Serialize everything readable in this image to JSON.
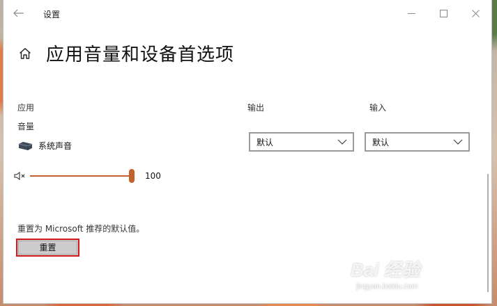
{
  "window": {
    "title": "设置",
    "page_title": "应用音量和设备首选项"
  },
  "columns": {
    "app_header": "应用",
    "output_header": "输出",
    "input_header": "输入"
  },
  "volume_label": "音量",
  "app": {
    "name": "系统声音",
    "volume": 100,
    "volume_text": "100"
  },
  "output_select": {
    "value": "默认"
  },
  "input_select": {
    "value": "默认"
  },
  "reset": {
    "description": "重置为 Microsoft 推荐的默认值。",
    "button_label": "重置"
  },
  "watermark": {
    "logo": "Bai 经验",
    "url": "jingyan.baidu.com"
  },
  "colors": {
    "accent": "#c4622d",
    "highlight": "#d11a1a"
  }
}
